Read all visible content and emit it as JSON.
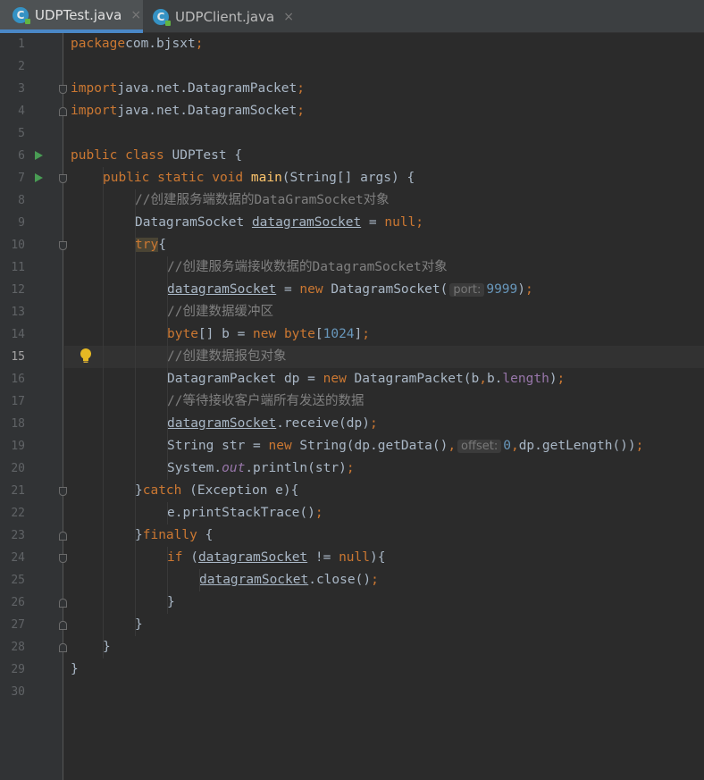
{
  "tabs": [
    {
      "label": "UDPTest.java",
      "icon": "java-class-icon",
      "icon_letter": "C",
      "active": true
    },
    {
      "label": "UDPClient.java",
      "icon": "java-class-icon",
      "icon_letter": "C",
      "active": false
    }
  ],
  "tab_close_glyph": "×",
  "current_line": 15,
  "colors": {
    "keyword": "#cc7832",
    "number": "#6897bb",
    "comment": "#808080",
    "method_decl": "#ffc66d",
    "field": "#9876aa",
    "text": "#a9b7c6",
    "background": "#2b2b2b",
    "run_icon": "#499c54"
  },
  "run_markers": [
    6,
    7
  ],
  "fold_markers": [
    {
      "line": 3,
      "type": "open"
    },
    {
      "line": 4,
      "type": "close"
    },
    {
      "line": 7,
      "type": "open"
    },
    {
      "line": 10,
      "type": "open"
    },
    {
      "line": 21,
      "type": "open"
    },
    {
      "line": 23,
      "type": "close"
    },
    {
      "line": 24,
      "type": "open"
    },
    {
      "line": 26,
      "type": "close"
    },
    {
      "line": 27,
      "type": "close"
    },
    {
      "line": 28,
      "type": "close"
    }
  ],
  "intention_bulb_line": 15,
  "code_lines": [
    {
      "n": 1,
      "indent": 0,
      "tokens": [
        [
          "kw",
          "package"
        ],
        [
          "",
          "com.bjsxt"
        ],
        [
          "kw",
          ";"
        ]
      ]
    },
    {
      "n": 2,
      "indent": 0,
      "tokens": []
    },
    {
      "n": 3,
      "indent": 0,
      "tokens": [
        [
          "kw",
          "import"
        ],
        [
          "",
          "java.net.DatagramPacket"
        ],
        [
          "kw",
          ";"
        ]
      ]
    },
    {
      "n": 4,
      "indent": 0,
      "tokens": [
        [
          "kw",
          "import"
        ],
        [
          "",
          "java.net.DatagramSocket"
        ],
        [
          "kw",
          ";"
        ]
      ]
    },
    {
      "n": 5,
      "indent": 0,
      "tokens": []
    },
    {
      "n": 6,
      "indent": 0,
      "tokens": [
        [
          "kw",
          "public class"
        ],
        [
          "",
          " UDPTest {"
        ]
      ]
    },
    {
      "n": 7,
      "indent": 1,
      "tokens": [
        [
          "kw",
          "public static void"
        ],
        [
          "",
          " "
        ],
        [
          "fn",
          "main"
        ],
        [
          "",
          "(String[] args) {"
        ]
      ]
    },
    {
      "n": 8,
      "indent": 2,
      "tokens": [
        [
          "cm",
          "//创建服务端数据的DataGramSocket对象"
        ]
      ]
    },
    {
      "n": 9,
      "indent": 2,
      "tokens": [
        [
          "",
          "DatagramSocket "
        ],
        [
          "ul",
          "datagramSocket"
        ],
        [
          "",
          " = "
        ],
        [
          "kw",
          "null;"
        ]
      ]
    },
    {
      "n": 10,
      "indent": 2,
      "tokens": [
        [
          "kwtry",
          "try"
        ],
        [
          "",
          "{"
        ]
      ]
    },
    {
      "n": 11,
      "indent": 3,
      "tokens": [
        [
          "cm",
          "//创建服务端接收数据的DatagramSocket对象"
        ]
      ]
    },
    {
      "n": 12,
      "indent": 3,
      "tokens": [
        [
          "ul",
          "datagramSocket"
        ],
        [
          "",
          " = "
        ],
        [
          "kw",
          "new"
        ],
        [
          "",
          " DatagramSocket("
        ],
        [
          "hint",
          "port:"
        ],
        [
          "num",
          "9999"
        ],
        [
          "",
          ")"
        ],
        [
          "kw",
          ";"
        ]
      ]
    },
    {
      "n": 13,
      "indent": 3,
      "tokens": [
        [
          "cm",
          "//创建数据缓冲区"
        ]
      ]
    },
    {
      "n": 14,
      "indent": 3,
      "tokens": [
        [
          "kw",
          "byte"
        ],
        [
          "",
          "[] b = "
        ],
        [
          "kw",
          "new byte"
        ],
        [
          "",
          "["
        ],
        [
          "num",
          "1024"
        ],
        [
          "",
          "]"
        ],
        [
          "kw",
          ";"
        ]
      ]
    },
    {
      "n": 15,
      "indent": 3,
      "tokens": [
        [
          "cm",
          "//创建数据报包对象"
        ]
      ]
    },
    {
      "n": 16,
      "indent": 3,
      "tokens": [
        [
          "",
          "DatagramPacket dp = "
        ],
        [
          "kw",
          "new"
        ],
        [
          "",
          " DatagramPacket(b"
        ],
        [
          "kw",
          ","
        ],
        [
          "",
          "b."
        ],
        [
          "fld",
          "length"
        ],
        [
          "",
          ")"
        ],
        [
          "kw",
          ";"
        ]
      ]
    },
    {
      "n": 17,
      "indent": 3,
      "tokens": [
        [
          "cm",
          "//等待接收客户端所有发送的数据"
        ]
      ]
    },
    {
      "n": 18,
      "indent": 3,
      "tokens": [
        [
          "ul",
          "datagramSocket"
        ],
        [
          "",
          ".receive(dp)"
        ],
        [
          "kw",
          ";"
        ]
      ]
    },
    {
      "n": 19,
      "indent": 3,
      "tokens": [
        [
          "",
          "String str = "
        ],
        [
          "kw",
          "new"
        ],
        [
          "",
          " String(dp.getData()"
        ],
        [
          "kw",
          ","
        ],
        [
          "hint",
          "offset:"
        ],
        [
          "num",
          "0"
        ],
        [
          "kw",
          ","
        ],
        [
          "",
          "dp.getLength())"
        ],
        [
          "kw",
          ";"
        ]
      ]
    },
    {
      "n": 20,
      "indent": 3,
      "tokens": [
        [
          "",
          "System."
        ],
        [
          "st",
          "out"
        ],
        [
          "",
          ".println(str)"
        ],
        [
          "kw",
          ";"
        ]
      ]
    },
    {
      "n": 21,
      "indent": 2,
      "tokens": [
        [
          "",
          "}"
        ],
        [
          "kw",
          "catch"
        ],
        [
          "",
          " (Exception e){"
        ]
      ]
    },
    {
      "n": 22,
      "indent": 3,
      "tokens": [
        [
          "",
          "e.printStackTrace()"
        ],
        [
          "kw",
          ";"
        ]
      ]
    },
    {
      "n": 23,
      "indent": 2,
      "tokens": [
        [
          "",
          "}"
        ],
        [
          "kw",
          "finally"
        ],
        [
          "",
          " {"
        ]
      ]
    },
    {
      "n": 24,
      "indent": 3,
      "tokens": [
        [
          "kw",
          "if"
        ],
        [
          "",
          " ("
        ],
        [
          "ul",
          "datagramSocket"
        ],
        [
          "",
          " != "
        ],
        [
          "kw",
          "null"
        ],
        [
          "",
          "){"
        ]
      ]
    },
    {
      "n": 25,
      "indent": 4,
      "tokens": [
        [
          "ul",
          "datagramSocket"
        ],
        [
          "",
          ".close()"
        ],
        [
          "kw",
          ";"
        ]
      ]
    },
    {
      "n": 26,
      "indent": 3,
      "tokens": [
        [
          "",
          "}"
        ]
      ]
    },
    {
      "n": 27,
      "indent": 2,
      "tokens": [
        [
          "",
          "}"
        ]
      ]
    },
    {
      "n": 28,
      "indent": 1,
      "tokens": [
        [
          "",
          "}"
        ]
      ]
    },
    {
      "n": 29,
      "indent": 0,
      "tokens": [
        [
          "",
          "}"
        ]
      ]
    },
    {
      "n": 30,
      "indent": 0,
      "tokens": []
    }
  ]
}
